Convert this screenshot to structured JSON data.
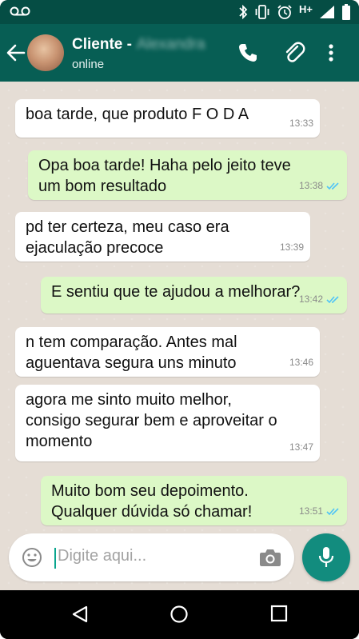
{
  "status_bar": {
    "network_label": "H+",
    "icons": [
      "voicemail-icon",
      "bluetooth-icon",
      "vibrate-icon",
      "alarm-icon",
      "signal-icon",
      "battery-icon"
    ]
  },
  "header": {
    "name": "Cliente -",
    "name_suffix_blurred": "Alexandra",
    "status": "online",
    "icons": [
      "back-arrow-icon",
      "phone-icon",
      "paperclip-icon",
      "more-vert-icon"
    ]
  },
  "messages": [
    {
      "direction": "in",
      "text": "boa tarde, que produto F O D A",
      "time": "13:33"
    },
    {
      "direction": "out",
      "text": "Opa boa tarde! Haha pelo jeito teve\num bom resultado",
      "time": "13:38",
      "read": true
    },
    {
      "direction": "in",
      "text": "pd ter certeza, meu caso era\nejaculação precoce",
      "time": "13:39"
    },
    {
      "direction": "out",
      "text": "E sentiu que te ajudou a melhorar?",
      "time": "13:42",
      "read": true
    },
    {
      "direction": "in",
      "text": "n tem comparação. Antes mal\naguentava segura uns minuto",
      "time": "13:46"
    },
    {
      "direction": "in",
      "text": "agora me sinto muito melhor,\nconsigo segurar bem e aproveitar o\nmomento",
      "time": "13:47"
    },
    {
      "direction": "out",
      "text": "Muito bom seu depoimento.\nQualquer dúvida só chamar!",
      "time": "13:51",
      "read": true
    }
  ],
  "composer": {
    "placeholder": "Digite aqui...",
    "icons": [
      "emoji-icon",
      "camera-icon",
      "mic-icon"
    ]
  },
  "colors": {
    "header": "#075e54",
    "status_bar": "#054d44",
    "outgoing_bubble": "#dcf8c6",
    "incoming_bubble": "#ffffff",
    "chat_background": "#e5ddd5",
    "read_ticks": "#4fc3f7",
    "mic_button": "#128c7e"
  }
}
